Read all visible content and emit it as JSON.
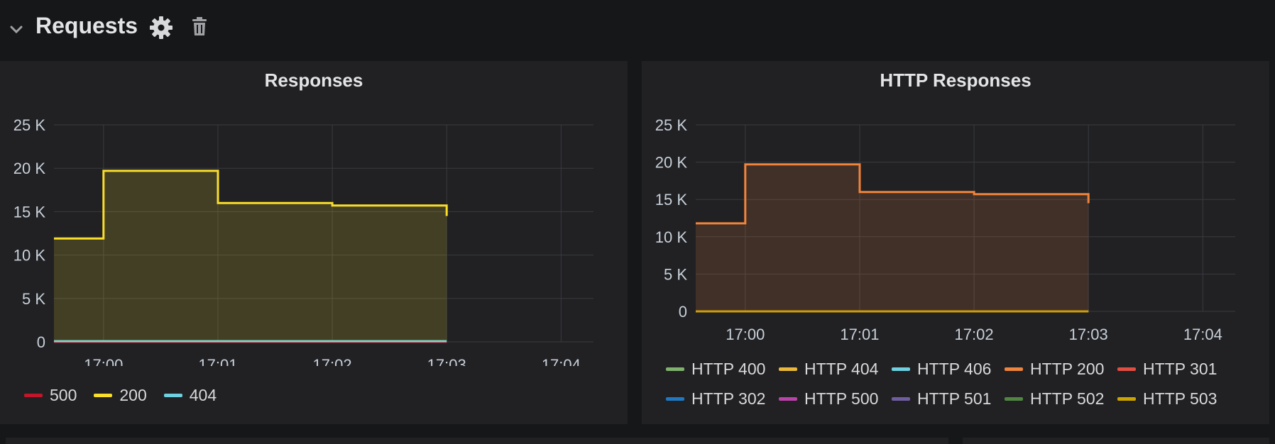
{
  "row": {
    "title": "Requests"
  },
  "icons": {
    "collapse": "chevron-down-icon",
    "settings": "gear-icon",
    "delete": "trash-icon"
  },
  "panels": [
    {
      "title": "Responses",
      "chart_data": {
        "type": "line",
        "x": [
          "16:59:00",
          "17:00:00",
          "17:01:00",
          "17:02:00",
          "17:03:00"
        ],
        "x_ticks": [
          "17:00",
          "17:01",
          "17:02",
          "17:03",
          "17:04"
        ],
        "y_ticks": [
          "0",
          "5 K",
          "10 K",
          "15 K",
          "20 K",
          "25 K"
        ],
        "ylim": [
          0,
          25000
        ],
        "grid": true,
        "step": true,
        "fill": true,
        "legend_position": "bottom-left",
        "series": [
          {
            "name": "500",
            "color": "#c4162a",
            "values": [
              0,
              0,
              0,
              0,
              0
            ]
          },
          {
            "name": "200",
            "color": "#fade2a",
            "values": [
              11900,
              19700,
              16000,
              15700,
              14500
            ]
          },
          {
            "name": "404",
            "color": "#6ed0e0",
            "values": [
              80,
              80,
              80,
              80,
              80
            ]
          }
        ]
      }
    },
    {
      "title": "HTTP Responses",
      "chart_data": {
        "type": "line",
        "x": [
          "16:59:00",
          "17:00:00",
          "17:01:00",
          "17:02:00",
          "17:03:00"
        ],
        "x_ticks": [
          "17:00",
          "17:01",
          "17:02",
          "17:03",
          "17:04"
        ],
        "y_ticks": [
          "0",
          "5 K",
          "10 K",
          "15 K",
          "20 K",
          "25 K"
        ],
        "ylim": [
          0,
          25000
        ],
        "grid": true,
        "step": true,
        "fill": true,
        "legend_position": "bottom",
        "series": [
          {
            "name": "HTTP 400",
            "color": "#7eb26d",
            "values": [
              0,
              0,
              0,
              0,
              0
            ]
          },
          {
            "name": "HTTP 404",
            "color": "#eab839",
            "values": [
              0,
              0,
              0,
              0,
              0
            ]
          },
          {
            "name": "HTTP 406",
            "color": "#6ed0e0",
            "values": [
              0,
              0,
              0,
              0,
              0
            ]
          },
          {
            "name": "HTTP 200",
            "color": "#ef843c",
            "values": [
              11800,
              19700,
              16000,
              15700,
              14500
            ]
          },
          {
            "name": "HTTP 301",
            "color": "#e24d42",
            "values": [
              0,
              0,
              0,
              0,
              0
            ]
          },
          {
            "name": "HTTP 302",
            "color": "#1f78c1",
            "values": [
              0,
              0,
              0,
              0,
              0
            ]
          },
          {
            "name": "HTTP 500",
            "color": "#ba43a9",
            "values": [
              0,
              0,
              0,
              0,
              0
            ]
          },
          {
            "name": "HTTP 501",
            "color": "#705da0",
            "values": [
              0,
              0,
              0,
              0,
              0
            ]
          },
          {
            "name": "HTTP 502",
            "color": "#508642",
            "values": [
              0,
              0,
              0,
              0,
              0
            ]
          },
          {
            "name": "HTTP 503",
            "color": "#cca300",
            "values": [
              0,
              0,
              0,
              0,
              0
            ]
          }
        ]
      }
    }
  ]
}
